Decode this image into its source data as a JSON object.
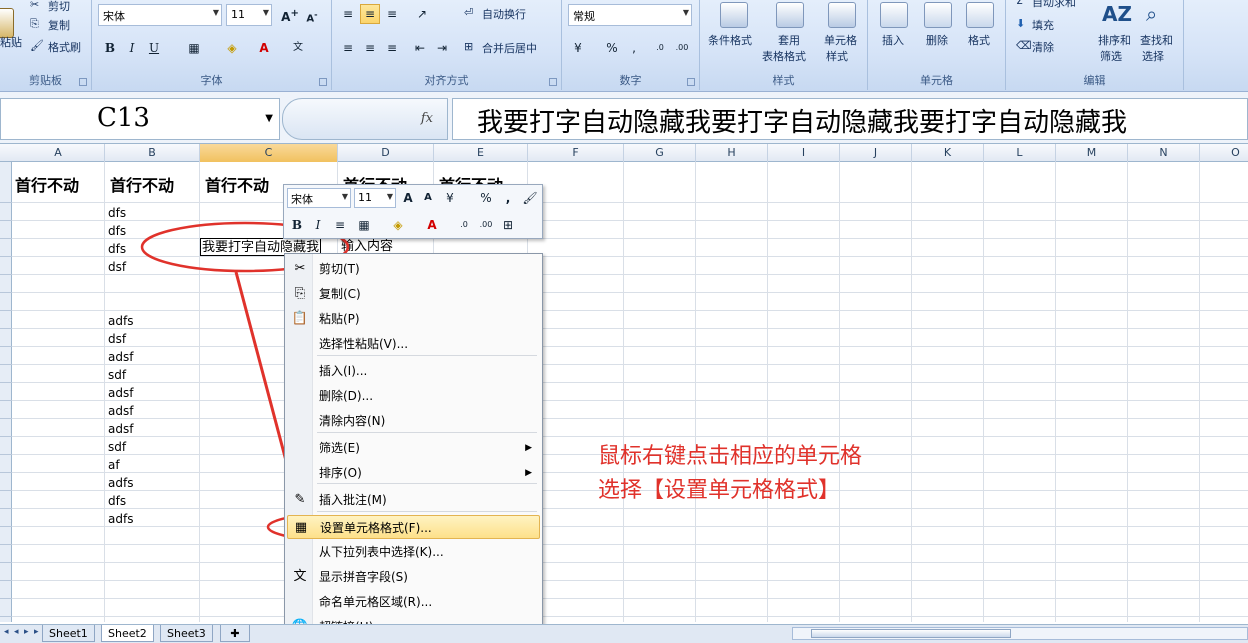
{
  "ribbon": {
    "clipboard": {
      "paste_label": "粘贴",
      "cut_label": "剪切",
      "copy_label": "复制",
      "format_painter_label": "格式刷",
      "group_label": "剪贴板"
    },
    "font": {
      "font_name": "宋体",
      "font_size": "11",
      "group_label": "字体",
      "bold": "B",
      "italic": "I",
      "underline": "U"
    },
    "alignment": {
      "wrap_label": "自动换行",
      "merge_label": "合并后居中",
      "group_label": "对齐方式"
    },
    "number": {
      "format": "常规",
      "group_label": "数字"
    },
    "styles": {
      "conditional_label": "条件格式",
      "table_label_1": "套用",
      "table_label_2": "表格格式",
      "cell_style_label_1": "单元格",
      "cell_style_label_2": "样式",
      "group_label": "样式"
    },
    "cells": {
      "insert_label": "插入",
      "delete_label": "删除",
      "format_label": "格式",
      "group_label": "单元格"
    },
    "editing": {
      "autosum_label": "自动求和",
      "fill_label": "填充",
      "clear_label": "清除",
      "sort_label_1": "排序和",
      "sort_label_2": "筛选",
      "find_label_1": "查找和",
      "find_label_2": "选择",
      "group_label": "编辑"
    }
  },
  "formula_bar": {
    "name_box": "C13",
    "fx": "fx",
    "content": "我要打字自动隐藏我要打字自动隐藏我要打字自动隐藏我"
  },
  "columns": [
    "A",
    "B",
    "C",
    "D",
    "E",
    "F",
    "G",
    "H",
    "I",
    "J",
    "K",
    "L",
    "M",
    "N",
    "O"
  ],
  "header_row": [
    "首行不动",
    "首行不动",
    "首行不动",
    "首行不动",
    "首行不动"
  ],
  "column_b_values": [
    "dfs",
    "dfs",
    "dfs",
    "dsf",
    "",
    "",
    "adfs",
    "dsf",
    "adsf",
    "sdf",
    "adsf",
    "adsf",
    "adsf",
    "sdf",
    "af",
    "adfs",
    "dfs",
    "adfs"
  ],
  "active_cell_text": "我要打字自动隐藏我",
  "overflow_text": "输入内容",
  "mini_toolbar": {
    "font": "宋体",
    "size": "11",
    "percent": "%",
    "comma": ","
  },
  "context_menu": {
    "items": [
      {
        "label": "剪切(T)",
        "icon": "scissors-icon"
      },
      {
        "label": "复制(C)",
        "icon": "copy-icon"
      },
      {
        "label": "粘贴(P)",
        "icon": "paste-icon"
      },
      {
        "label": "选择性粘贴(V)...",
        "icon": ""
      },
      {
        "label": "插入(I)...",
        "icon": ""
      },
      {
        "label": "删除(D)...",
        "icon": ""
      },
      {
        "label": "清除内容(N)",
        "icon": ""
      },
      {
        "label": "筛选(E)",
        "icon": "",
        "submenu": true
      },
      {
        "label": "排序(O)",
        "icon": "",
        "submenu": true
      },
      {
        "label": "插入批注(M)",
        "icon": "comment-icon"
      },
      {
        "label": "设置单元格格式(F)...",
        "icon": "format-cells-icon",
        "highlighted": true
      },
      {
        "label": "从下拉列表中选择(K)...",
        "icon": ""
      },
      {
        "label": "显示拼音字段(S)",
        "icon": "phonetic-icon"
      },
      {
        "label": "命名单元格区域(R)...",
        "icon": ""
      },
      {
        "label": "超链接(H)...",
        "icon": "hyperlink-icon"
      }
    ]
  },
  "annotation": {
    "line1": "鼠标右键点击相应的单元格",
    "line2": "选择【设置单元格格式】",
    "color": "#e0322b"
  },
  "sheets": [
    "Sheet1",
    "Sheet2",
    "Sheet3"
  ],
  "active_sheet": "Sheet2"
}
